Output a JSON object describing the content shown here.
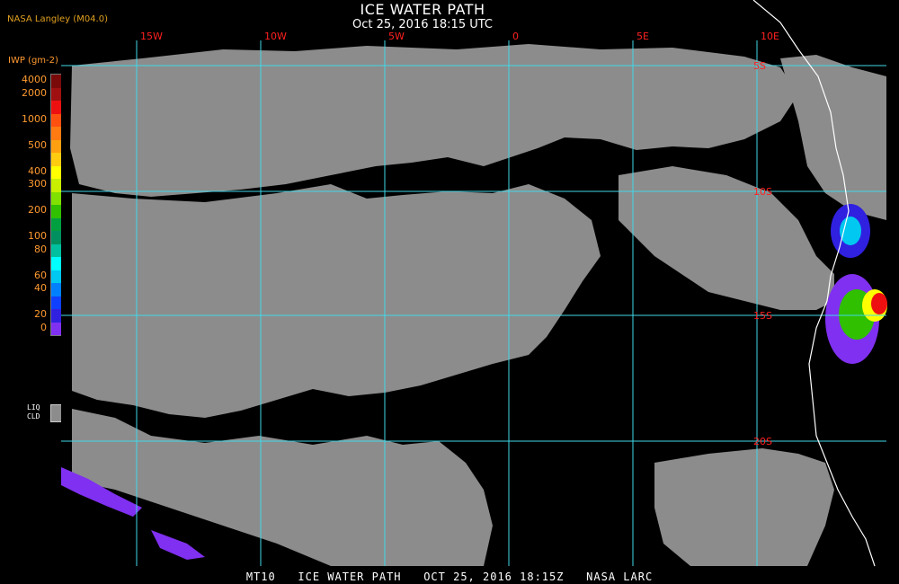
{
  "title": "ICE WATER PATH",
  "subtitle": "Oct 25, 2016 18:15 UTC",
  "credit": "NASA Langley (M04.0)",
  "legend": {
    "title": "IWP (gm-2)",
    "levels": [
      {
        "label": "4000",
        "color": "#7a0a0a"
      },
      {
        "label": "2000",
        "color": "#a01010"
      },
      {
        "label": "",
        "color": "#ee1010"
      },
      {
        "label": "1000",
        "color": "#ff5010"
      },
      {
        "label": "",
        "color": "#ff7a10"
      },
      {
        "label": "500",
        "color": "#ffa010"
      },
      {
        "label": "",
        "color": "#ffcc10"
      },
      {
        "label": "400",
        "color": "#ffff00"
      },
      {
        "label": "300",
        "color": "#c8f000"
      },
      {
        "label": "",
        "color": "#80e000"
      },
      {
        "label": "200",
        "color": "#30c000"
      },
      {
        "label": "",
        "color": "#00a040"
      },
      {
        "label": "100",
        "color": "#009060"
      },
      {
        "label": "80",
        "color": "#00c0a0"
      },
      {
        "label": "",
        "color": "#00ffff"
      },
      {
        "label": "60",
        "color": "#00c8f0"
      },
      {
        "label": "40",
        "color": "#0080ff"
      },
      {
        "label": "",
        "color": "#1040ff"
      },
      {
        "label": "20",
        "color": "#3020e0"
      },
      {
        "label": "0",
        "color": "#8030f0"
      }
    ],
    "liq_label": "LIQ\nCLD",
    "liq_color": "#8c8c8c"
  },
  "map": {
    "ocean_color": "#000000",
    "cloud_color": "#8c8c8c",
    "grid_color": "#40d8e8",
    "coast_color": "#ffffff",
    "lon_labels": [
      "15W",
      "10W",
      "5W",
      "0",
      "5E",
      "10E"
    ],
    "lat_labels": [
      "5S",
      "10S",
      "15S",
      "20S"
    ]
  },
  "footer": "MT10   ICE WATER PATH   OCT 25, 2016 18:15Z   NASA LARC"
}
